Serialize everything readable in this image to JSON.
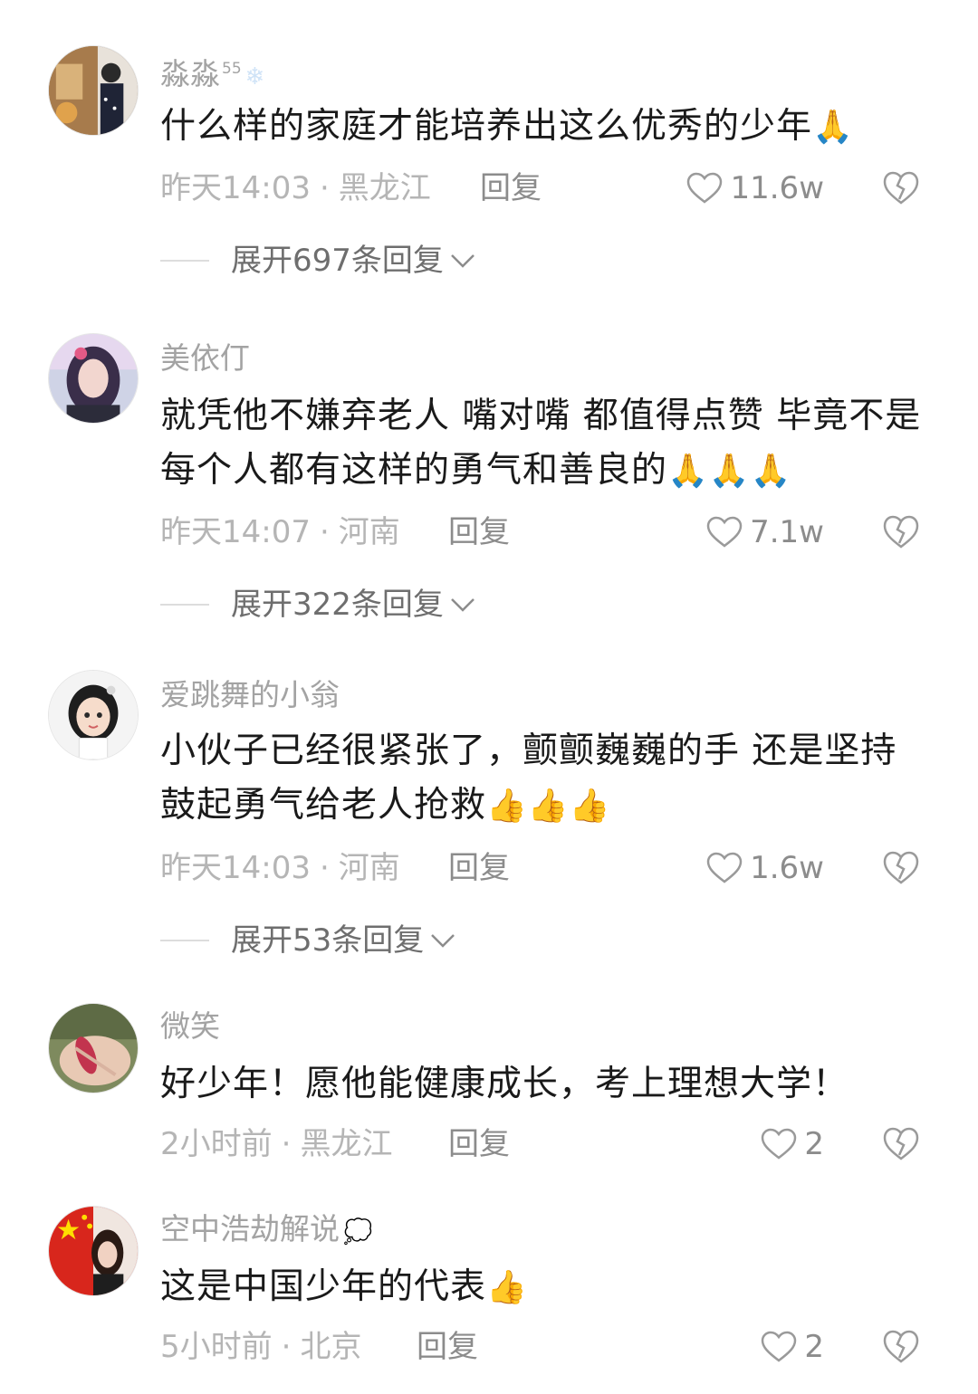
{
  "comments": [
    {
      "username": "淼淼",
      "badge": "55",
      "snow_icon": "snowflake-icon",
      "content": "什么样的家庭才能培养出这么优秀的少年",
      "emoji": "🙏",
      "time": "昨天14:03",
      "location": "黑龙江",
      "reply_label": "回复",
      "likes": "11.6w",
      "expand_label": "展开697条回复"
    },
    {
      "username": "美依仃",
      "content": "就凭他不嫌弃老人 嘴对嘴 都值得点赞 毕竟不是每个人都有这样的勇气和善良的",
      "emoji": "🙏🙏🙏",
      "time": "昨天14:07",
      "location": "河南",
      "reply_label": "回复",
      "likes": "7.1w",
      "expand_label": "展开322条回复"
    },
    {
      "username": "爱跳舞的小翁",
      "content": "小伙子已经很紧张了，颤颤巍巍的手 还是坚持鼓起勇气给老人抢救",
      "emoji": "👍👍👍",
      "time": "昨天14:03",
      "location": "河南",
      "reply_label": "回复",
      "likes": "1.6w",
      "expand_label": "展开53条回复"
    },
    {
      "username": "微笑",
      "content": "好少年！愿他能健康成长，考上理想大学！",
      "emoji": "",
      "time": "2小时前",
      "location": "黑龙江",
      "reply_label": "回复",
      "likes": "2"
    },
    {
      "username": "空中浩劫解说",
      "bubble_icon": "thought-bubble-icon",
      "content": "这是中国少年的代表",
      "emoji": "👍",
      "time": "5小时前",
      "location": "北京",
      "reply_label": "回复",
      "likes": "2"
    }
  ],
  "separator": "·",
  "colors": {
    "username": "#a3a3a3",
    "meta": "#b5b5b5",
    "text": "#1a1a1a",
    "action": "#8c8c8c"
  }
}
